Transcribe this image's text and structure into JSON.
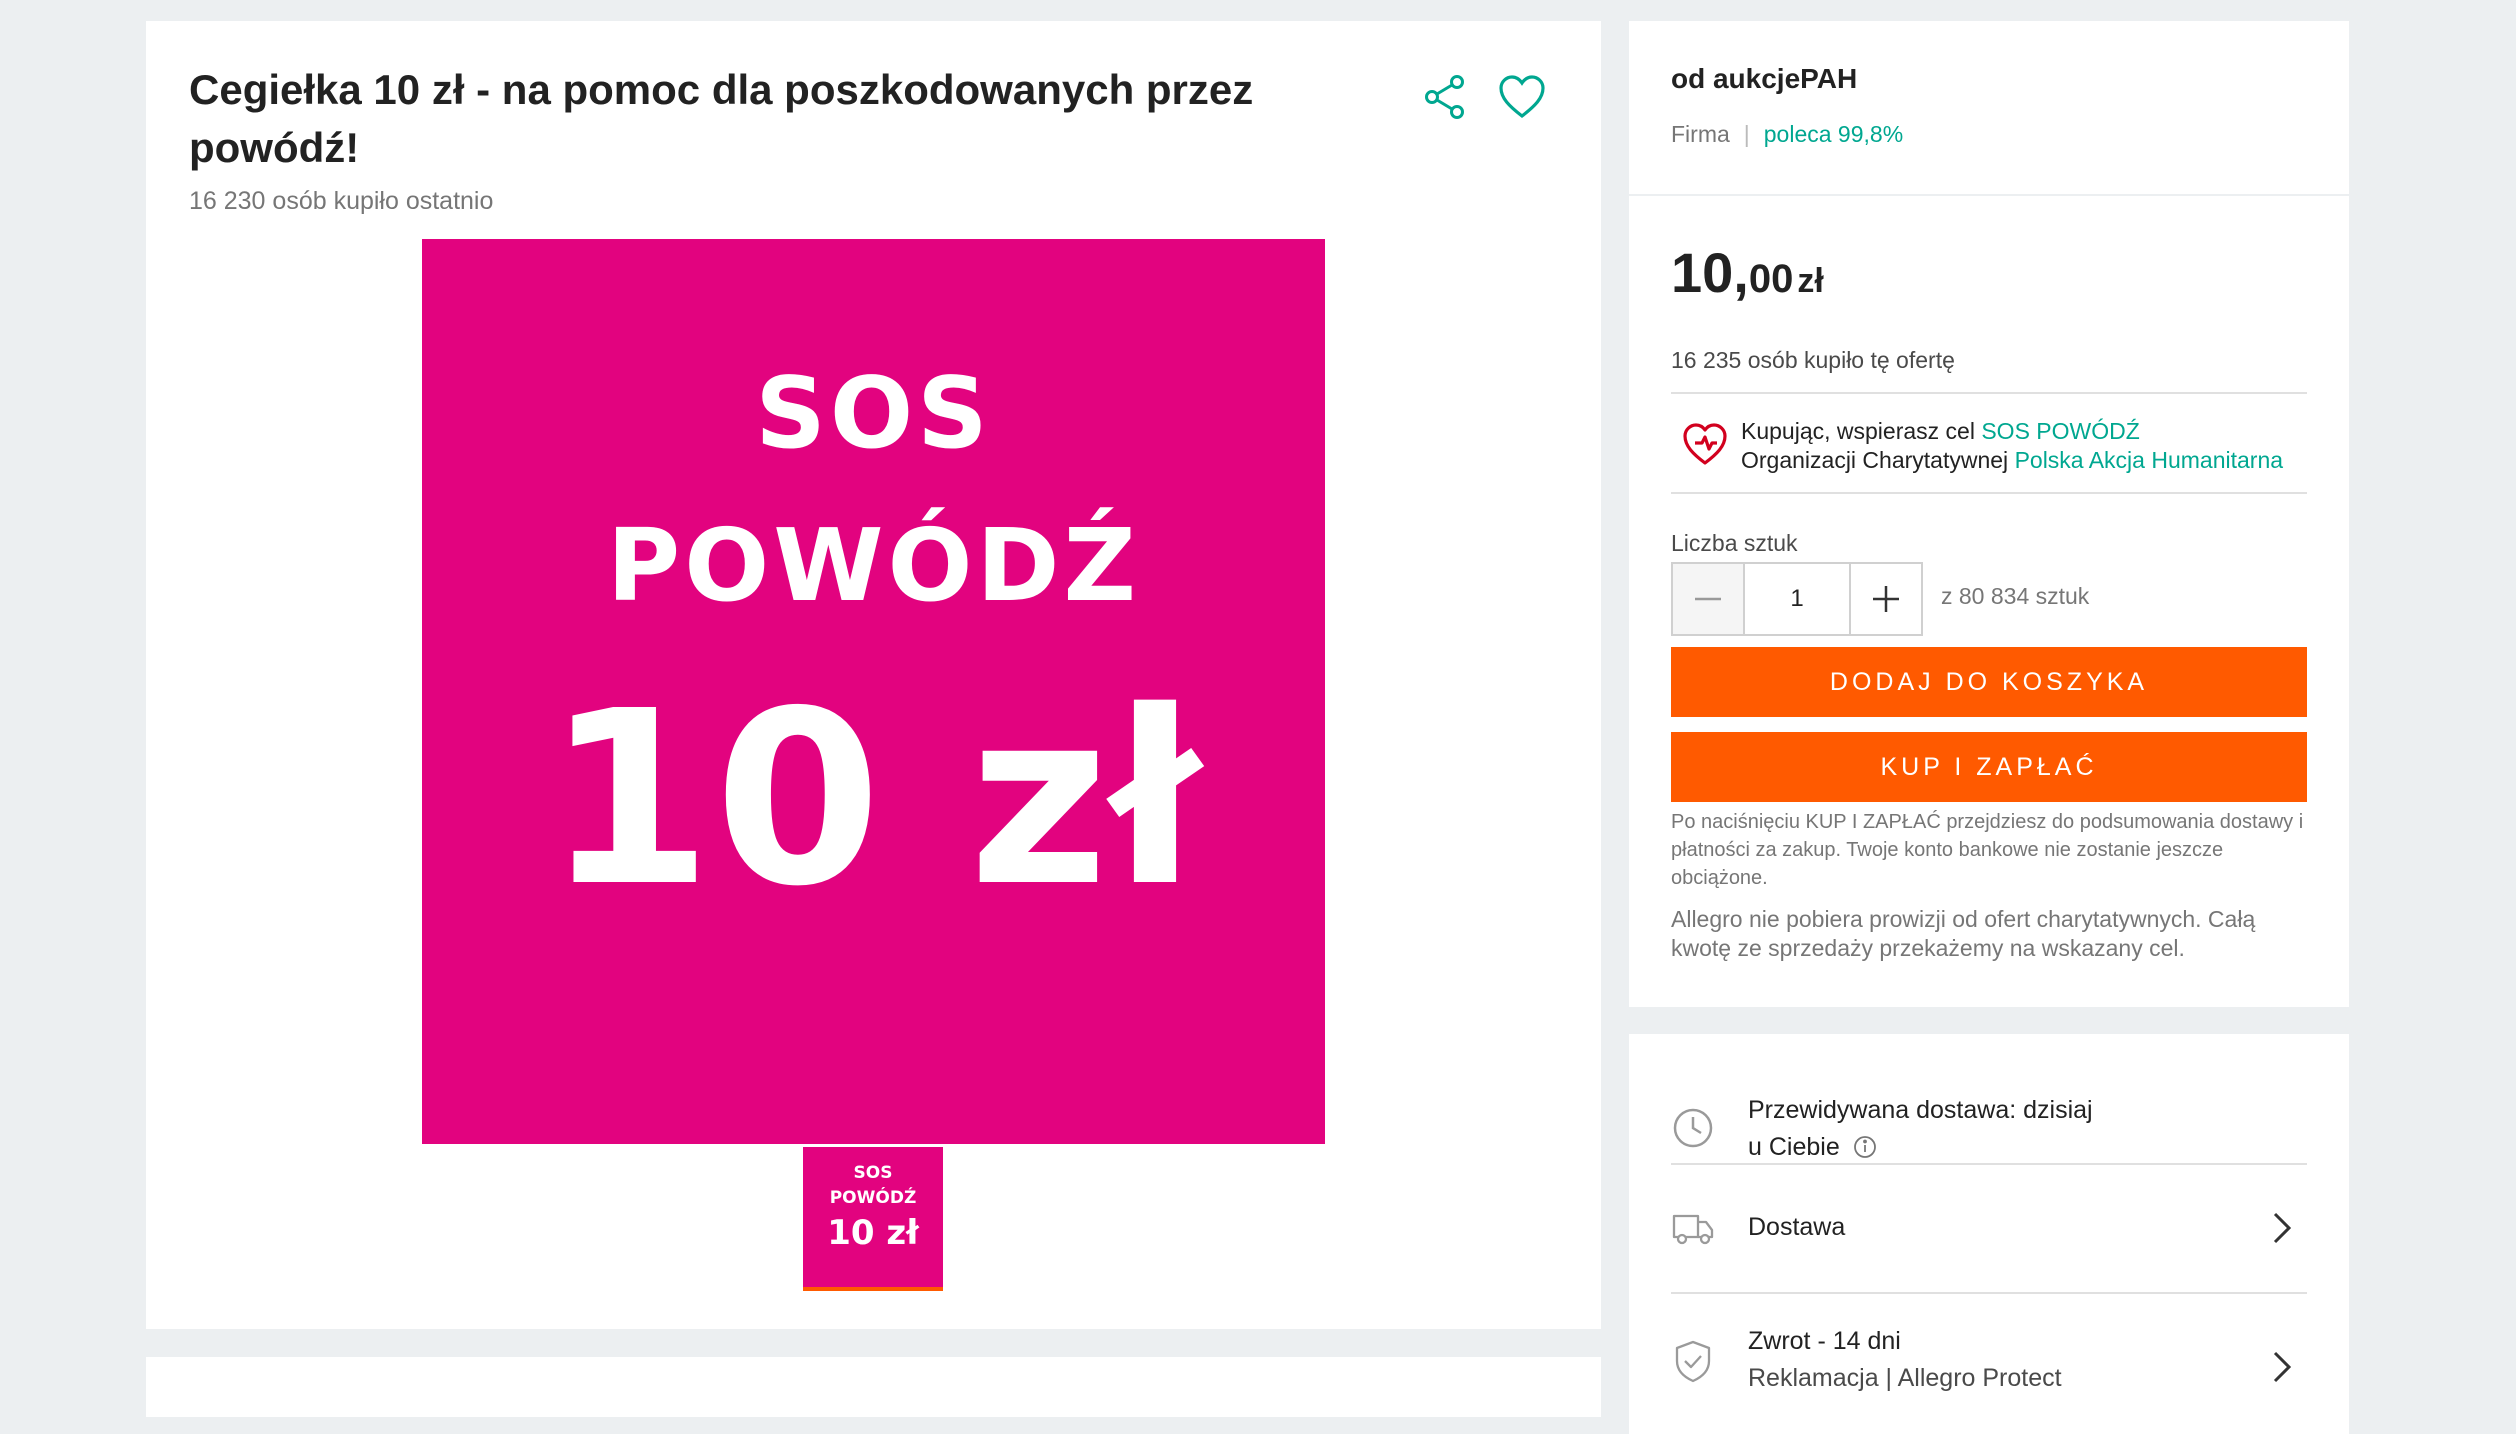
{
  "product": {
    "title": "Cegiełka 10 zł - na pomoc dla poszkodowanych przez powódź!",
    "bought_recently": "16 230 osób kupiło ostatnio",
    "image": {
      "line1": "SOS",
      "line2": "POWÓDŹ",
      "line3": "10 zł",
      "background": "#e2037f"
    },
    "thumb": {
      "line1": "SOS",
      "line2": "POWÓDŹ",
      "line3": "10 zł"
    }
  },
  "icons": {
    "share": "share-icon",
    "favorite": "heart-icon",
    "charity": "charity-heart-icon",
    "clock": "clock-icon",
    "truck": "truck-icon",
    "shield": "shield-icon",
    "info": "info-icon",
    "chevron": "chevron-right-icon"
  },
  "colors": {
    "accent_orange": "#ff5a00",
    "link_teal": "#00a790",
    "charity_red": "#d2001e",
    "page_bg": "#eceff1"
  },
  "seller": {
    "label": "od aukcjePAH",
    "type": "Firma",
    "recommend": "poleca 99,8%"
  },
  "offer": {
    "price_main": "10,",
    "price_cents": "00",
    "currency": "zł",
    "bought_count": "16 235 osób kupiło tę ofertę",
    "charity_line1_prefix": "Kupując, wspierasz cel",
    "charity_goal": "SOS POWÓDŹ",
    "charity_line2_prefix": "Organizacji Charytatywnej",
    "charity_org": "Polska Akcja Humanitarna",
    "qty_label": "Liczba sztuk",
    "qty_value": "1",
    "qty_available": "z 80 834 sztuk",
    "add_to_cart": "DODAJ DO KOSZYKA",
    "buy_now": "KUP I ZAPŁAĆ",
    "note_buy": "Po naciśnięciu KUP I ZAPŁAĆ przejdziesz do podsumowania dostawy i płatności za zakup. Twoje konto bankowe nie zostanie jeszcze obciążone.",
    "note_commission": "Allegro nie pobiera prowizji od ofert charytatywnych. Całą kwotę ze sprzedaży przekażemy na wskazany cel."
  },
  "delivery": {
    "expected_line1": "Przewidywana dostawa: dzisiaj",
    "expected_line2": "u Ciebie",
    "shipping": "Dostawa",
    "returns_title": "Zwrot - 14 dni",
    "returns_sub": "Reklamacja | Allegro Protect"
  }
}
